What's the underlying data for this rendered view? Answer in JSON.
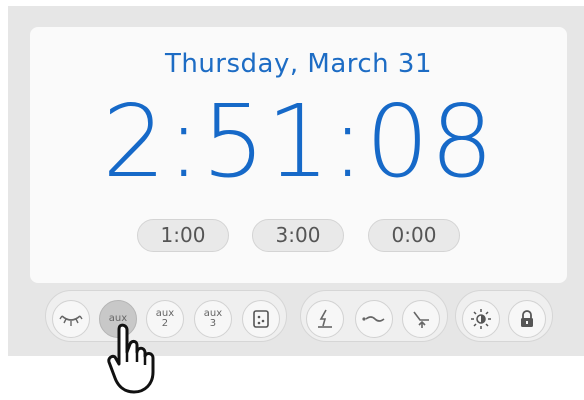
{
  "screen": {
    "date": "Thursday, March 31",
    "time": "2:51:08",
    "presets": [
      {
        "label": "1:00"
      },
      {
        "label": "3:00"
      },
      {
        "label": "0:00"
      }
    ]
  },
  "toolbar": {
    "aux1": {
      "label": "aux"
    },
    "aux2": {
      "line1": "aux",
      "line2": "2"
    },
    "aux3": {
      "line1": "aux",
      "line2": "3"
    },
    "icons": [
      "eye-light-icon",
      "aux-icon",
      "aux-2-icon",
      "aux-3-icon",
      "dice-icon",
      "lightning-icon",
      "wave-icon",
      "recline-icon",
      "brightness-icon",
      "lock-icon"
    ]
  },
  "colors": {
    "accent": "#1669c8",
    "panel": "#e6e6e6",
    "screen": "#fafafa"
  }
}
